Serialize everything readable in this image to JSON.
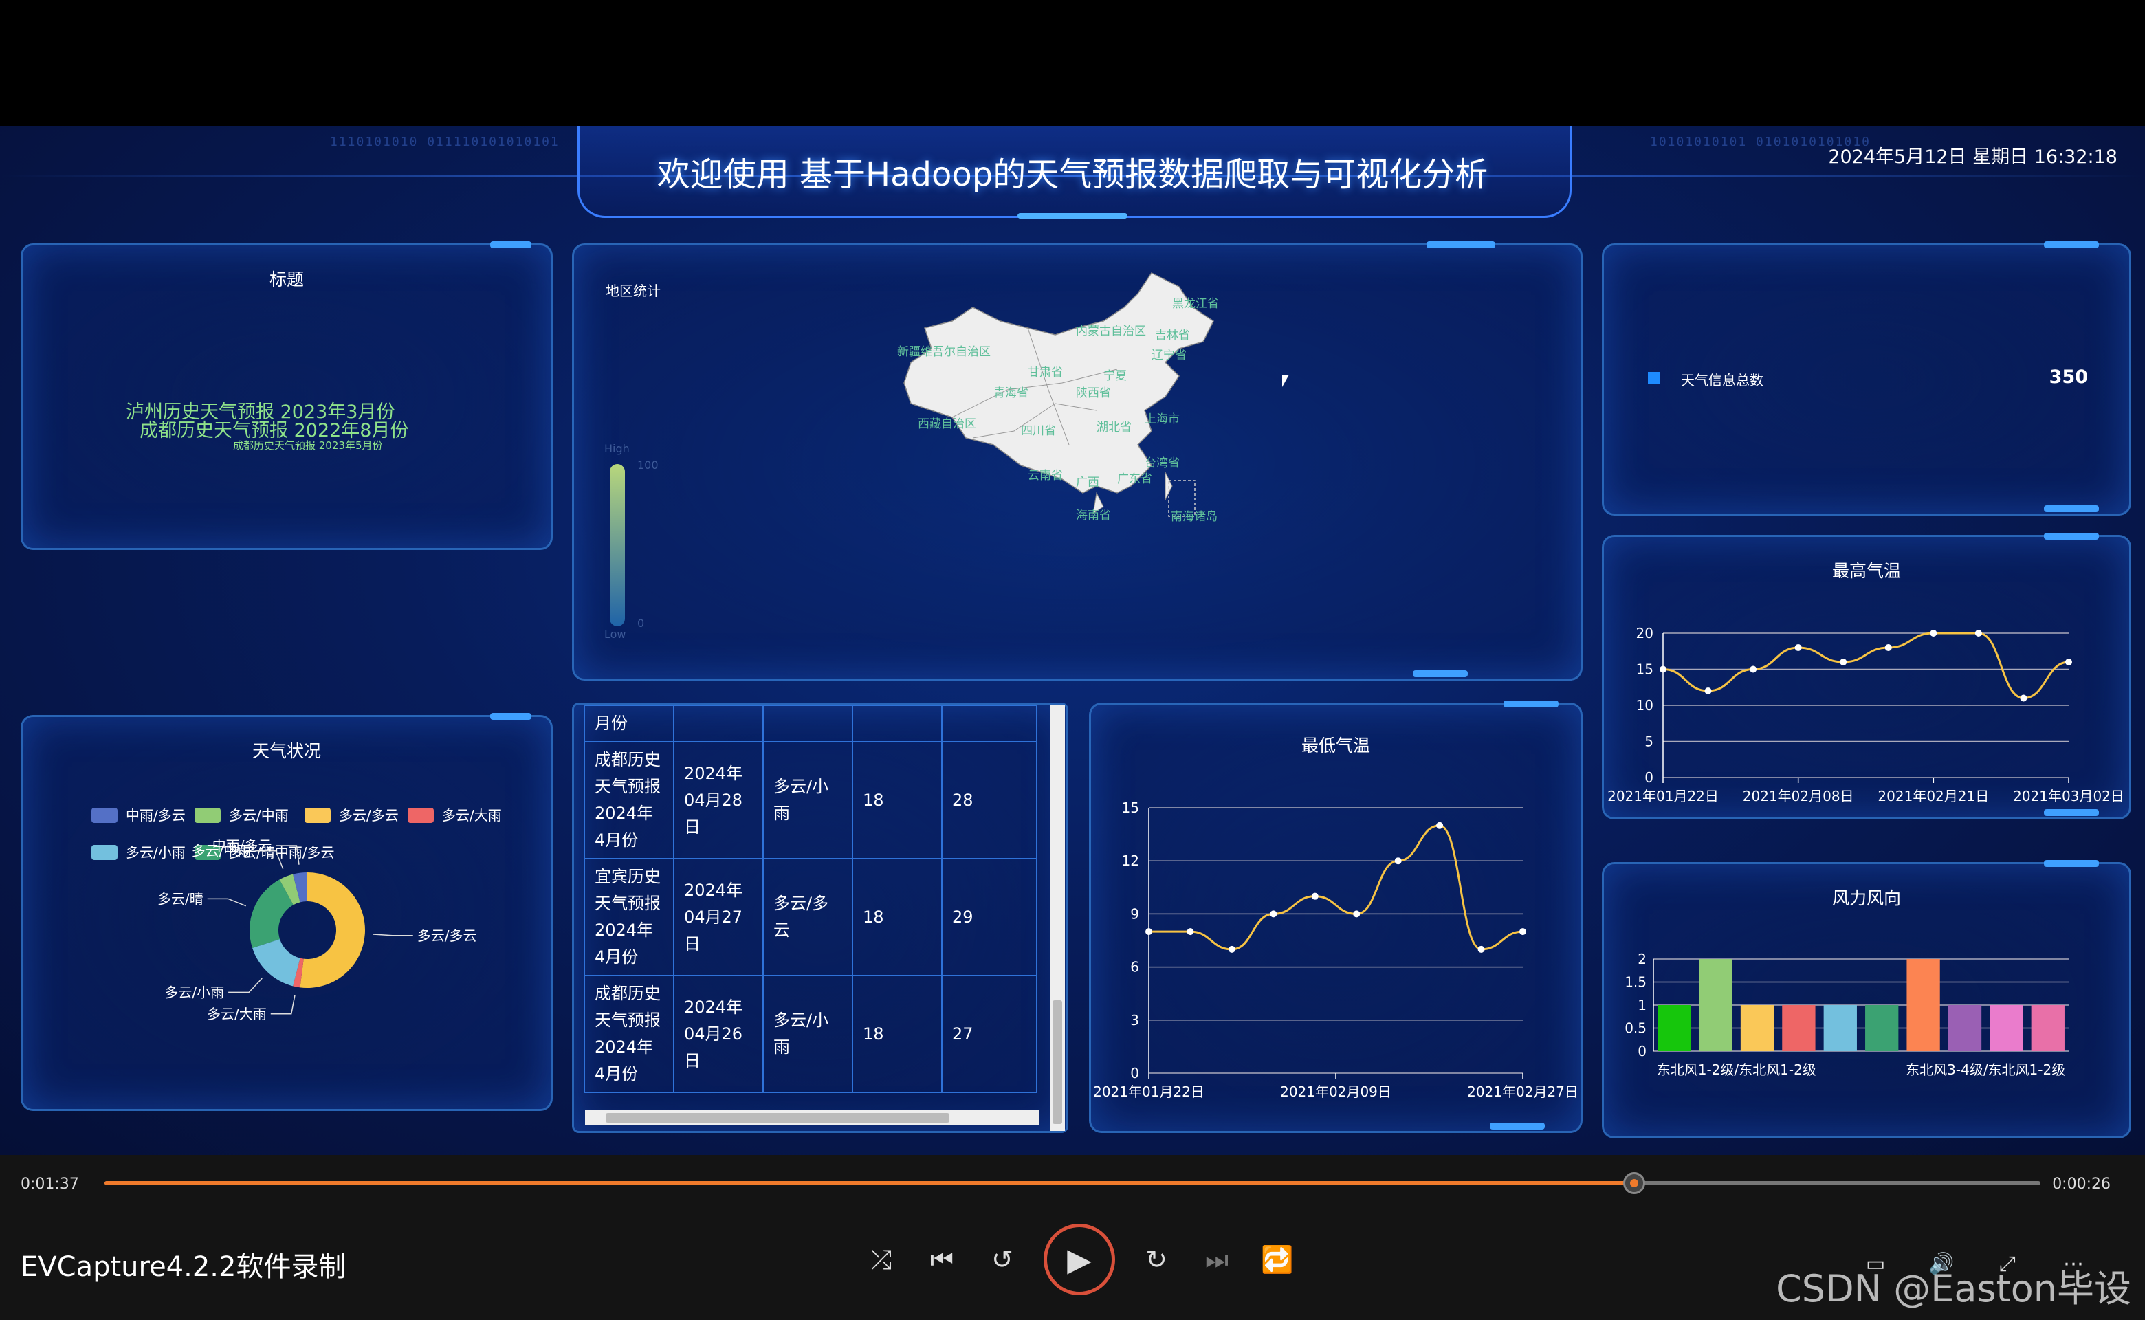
{
  "header": {
    "title": "欢迎使用 基于Hadoop的天气预报数据爬取与可视化分析",
    "datetime": "2024年5月12日 星期日 16:32:18",
    "binary_left": "1110101010 011110101010101",
    "binary_right": "10101010101 0101010101010"
  },
  "title_panel": {
    "title": "标题",
    "lines": [
      "泸州历史天气预报 2023年3月份",
      "成都历史天气预报 2022年8月份",
      "成都历史天气预报 2023年5月份"
    ]
  },
  "map_panel": {
    "title": "地区统计",
    "scale_high": "High",
    "scale_low": "Low",
    "scale_max": "100",
    "scale_min": "0",
    "regions": [
      "黑龙江省",
      "内蒙古自治区",
      "吉林省",
      "新疆维吾尔自治区",
      "辽宁省",
      "甘肃省",
      "宁夏",
      "青海省",
      "陕西省",
      "西藏自治区",
      "四川省",
      "湖北省",
      "云南省",
      "广西",
      "广东省",
      "海南省",
      "南海诸岛",
      "台湾省",
      "上海市"
    ]
  },
  "total_panel": {
    "label": "天气信息总数",
    "value": "350",
    "color": "#1e8bff"
  },
  "weather_panel": {
    "title": "天气状况"
  },
  "table": {
    "header": "月份",
    "rows": [
      {
        "c1": "成都历史天气预报2024年4月份",
        "c2": "2024年04月28日",
        "c3": "多云/小雨",
        "c4": "18",
        "c5": "28"
      },
      {
        "c1": "宜宾历史天气预报2024年4月份",
        "c2": "2024年04月27日",
        "c3": "多云/多云",
        "c4": "18",
        "c5": "29"
      },
      {
        "c1": "成都历史天气预报2024年4月份",
        "c2": "2024年04月26日",
        "c3": "多云/小雨",
        "c4": "18",
        "c5": "27"
      }
    ]
  },
  "player": {
    "elapsed": "0:01:37",
    "remaining": "0:00:26",
    "progress": 0.79,
    "app_label": "EVCapture4.2.2软件录制",
    "watermark": "CSDN @Easton毕设"
  },
  "chart_data": [
    {
      "type": "pie",
      "title": "天气状况",
      "donut": true,
      "legend": [
        "中雨/多云",
        "多云/中雨",
        "多云/多云",
        "多云/大雨",
        "多云/小雨",
        "多云/晴中雨/多云"
      ],
      "slices": [
        {
          "name": "多云/多云",
          "value": 52,
          "color": "#f7c343"
        },
        {
          "name": "多云/大雨",
          "value": 2,
          "color": "#ee6666"
        },
        {
          "name": "多云/小雨",
          "value": 16,
          "color": "#73c0de"
        },
        {
          "name": "多云/晴",
          "value": 22,
          "color": "#3ba272"
        },
        {
          "name": "多云/中雨",
          "value": 4,
          "color": "#91cc75"
        },
        {
          "name": "中雨/多云",
          "value": 4,
          "color": "#5470c6"
        }
      ]
    },
    {
      "type": "line",
      "title": "最高气温",
      "x": [
        "2021年01月22日",
        "2021年02月08日",
        "2021年02月21日",
        "2021年03月02日"
      ],
      "y": [
        15,
        12,
        15,
        18,
        16,
        18,
        20,
        20,
        11,
        16
      ],
      "yticks": [
        0,
        5,
        10,
        15,
        20
      ],
      "ylim": [
        0,
        20
      ],
      "color": "#f7c343"
    },
    {
      "type": "line",
      "title": "最低气温",
      "x": [
        "2021年01月22日",
        "2021年02月09日",
        "2021年02月27日"
      ],
      "y": [
        8,
        8,
        7,
        9,
        10,
        9,
        12,
        14,
        7,
        8
      ],
      "yticks": [
        0,
        3,
        6,
        9,
        12,
        15
      ],
      "ylim": [
        0,
        15
      ],
      "color": "#f7c343"
    },
    {
      "type": "bar",
      "title": "风力风向",
      "x": [
        "东北风1-2级/东北风1-2级",
        "东北风3-4级/东北风1-2级"
      ],
      "values": [
        1,
        2,
        1,
        1,
        1,
        1,
        2,
        1,
        1,
        1
      ],
      "colors": [
        "#16c60c",
        "#91cc75",
        "#fac858",
        "#ee6666",
        "#73c0de",
        "#3ba272",
        "#fc8452",
        "#9a60b4",
        "#ea7ccc",
        "#e870a8"
      ],
      "yticks": [
        0,
        0.5,
        1,
        1.5,
        2
      ],
      "ylim": [
        0,
        2
      ]
    }
  ]
}
